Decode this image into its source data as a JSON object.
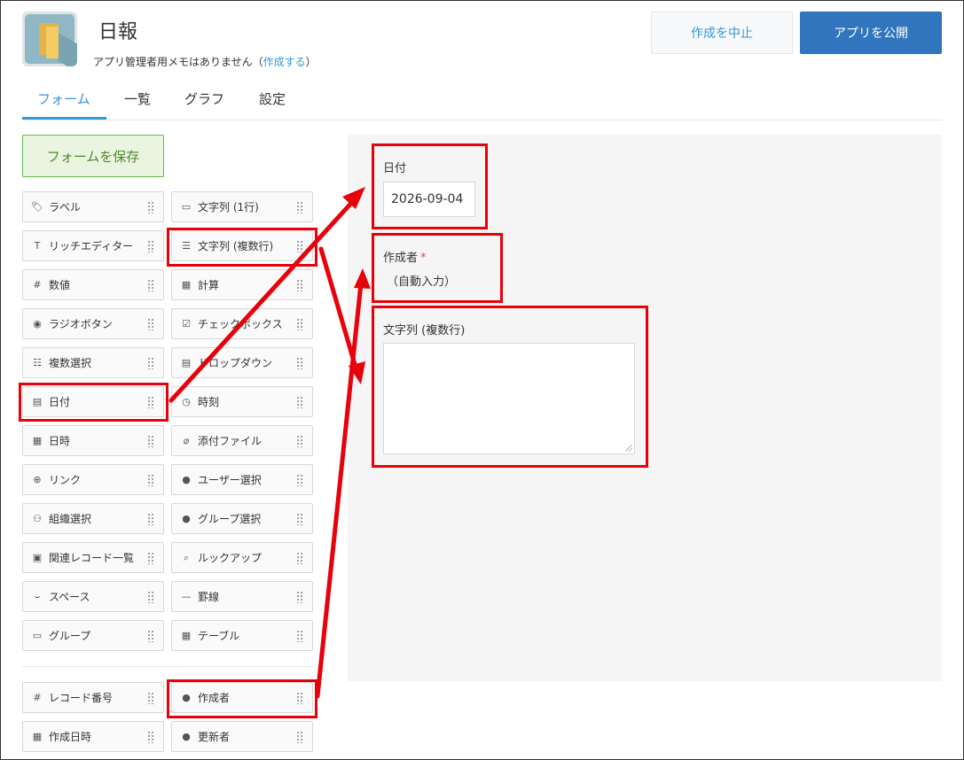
{
  "app": {
    "title": "日報",
    "memo_prefix": "アプリ管理者用メモはありません（",
    "memo_link": "作成する",
    "memo_suffix": "）"
  },
  "actions": {
    "cancel_label": "作成を中止",
    "publish_label": "アプリを公開"
  },
  "tabs": [
    {
      "label": "フォーム",
      "active": true
    },
    {
      "label": "一覧",
      "active": false
    },
    {
      "label": "グラフ",
      "active": false
    },
    {
      "label": "設定",
      "active": false
    }
  ],
  "save_label": "フォームを保存",
  "palette": {
    "left": [
      {
        "label": "ラベル",
        "icon": "tag-icon"
      },
      {
        "label": "リッチエディター",
        "icon": "rich-text-icon"
      },
      {
        "label": "数値",
        "icon": "number-icon"
      },
      {
        "label": "ラジオボタン",
        "icon": "radio-icon"
      },
      {
        "label": "複数選択",
        "icon": "multi-select-icon"
      },
      {
        "label": "日付",
        "icon": "calendar-icon"
      },
      {
        "label": "日時",
        "icon": "datetime-icon"
      },
      {
        "label": "リンク",
        "icon": "globe-icon"
      },
      {
        "label": "組織選択",
        "icon": "org-icon"
      },
      {
        "label": "関連レコード一覧",
        "icon": "related-records-icon"
      },
      {
        "label": "スペース",
        "icon": "space-icon"
      },
      {
        "label": "グループ",
        "icon": "group-field-icon"
      }
    ],
    "right": [
      {
        "label": "文字列 (1行)",
        "icon": "single-line-text-icon"
      },
      {
        "label": "文字列 (複数行)",
        "icon": "multi-line-text-icon"
      },
      {
        "label": "計算",
        "icon": "calculator-icon"
      },
      {
        "label": "チェックボックス",
        "icon": "checkbox-icon"
      },
      {
        "label": "ドロップダウン",
        "icon": "dropdown-icon"
      },
      {
        "label": "時刻",
        "icon": "clock-icon"
      },
      {
        "label": "添付ファイル",
        "icon": "paperclip-icon"
      },
      {
        "label": "ユーザー選択",
        "icon": "user-icon"
      },
      {
        "label": "グループ選択",
        "icon": "users-icon"
      },
      {
        "label": "ルックアップ",
        "icon": "lookup-icon"
      },
      {
        "label": "罫線",
        "icon": "line-icon"
      },
      {
        "label": "テーブル",
        "icon": "table-icon"
      }
    ],
    "system_left": [
      {
        "label": "レコード番号",
        "icon": "number-icon"
      },
      {
        "label": "作成日時",
        "icon": "datetime-icon"
      }
    ],
    "system_right": [
      {
        "label": "作成者",
        "icon": "user-icon"
      },
      {
        "label": "更新者",
        "icon": "user-icon"
      }
    ]
  },
  "form": {
    "date_field": {
      "label": "日付",
      "value": "2026-09-04"
    },
    "creator_field": {
      "label": "作成者",
      "required_mark": "*",
      "value": "（自動入力）"
    },
    "multiline_field": {
      "label": "文字列 (複数行)"
    }
  },
  "annotation_color": "#e8000b"
}
